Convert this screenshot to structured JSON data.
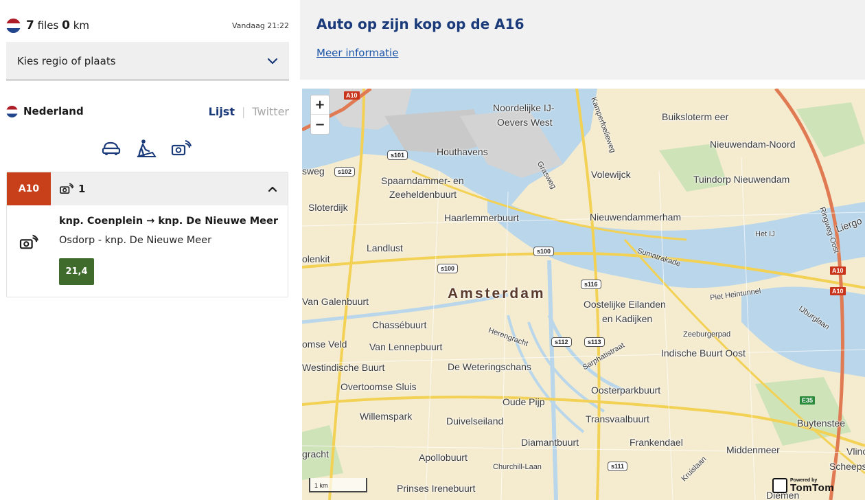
{
  "summary": {
    "files_count": "7",
    "files_label": "files",
    "km_count": "0",
    "km_label": "km",
    "timestamp": "Vandaag 21:22"
  },
  "region_select": {
    "placeholder": "Kies regio of plaats"
  },
  "country": {
    "name": "Nederland"
  },
  "view_tabs": {
    "list": "Lijst",
    "twitter": "Twitter",
    "active": "Lijst"
  },
  "filters": [
    "traffic-jam-icon",
    "roadworks-icon",
    "speed-camera-icon"
  ],
  "road_group": {
    "road": "A10",
    "badge_color": "#c8401a",
    "incident_icon": "speed-camera-icon",
    "count": "1",
    "incidents": [
      {
        "route": "knp. Coenplein → knp. De Nieuwe Meer",
        "stretch": "Osdorp - knp. De Nieuwe Meer",
        "hectometer": "21,4"
      }
    ]
  },
  "news": {
    "title": "Auto op zijn kop op de A16",
    "link": "Meer informatie"
  },
  "map": {
    "zoom_in": "+",
    "zoom_out": "−",
    "city": "Amsterdam",
    "labels": [
      "Noordelijke IJ-",
      "Oevers West",
      "Kamperfoelieweg",
      "Buiksloterm eer",
      "Nieuwendam-Noord",
      "Houthavens",
      "Grasweg",
      "Volewijck",
      "Tuindorp Nieuwendam",
      "Spaarndammer- en",
      "Zeeheldenbuurt",
      "Sloterdijk",
      "Haarlemmerbuurt",
      "Nieuwendammerham",
      "Liergo",
      "Landlust",
      "Het IJ",
      "Sumatrakade",
      "olenkit",
      "Ringweg-Oost",
      "Oostelijke Eilanden",
      "en Kadijken",
      "Van Galenbuurt",
      "Piet Heintunnel",
      "Chassébuurt",
      "Herengracht",
      "Zeeburgerpad",
      "IJburglaan",
      "omse Veld",
      "Van Lennepbuurt",
      "Sarphatistraat",
      "Indische Buurt Oost",
      "Westindische Buurt",
      "De Weteringschans",
      "Overtoomse Sluis",
      "Oosterparkbuurt",
      "Oude Pijp",
      "Willemspark",
      "Duivelseiland",
      "Transvaalbuurt",
      "Buytenstee",
      "Diamantbuurt",
      "Frankendael",
      "Middenmeer",
      "gracht",
      "Apollobuurt",
      "Vlinc",
      "Churchill-Laan",
      "Kruislaan",
      "Scheeps",
      "Prinses Irenebuurt",
      "Diemen",
      "sweg"
    ],
    "shields": [
      "s101",
      "s102",
      "s100",
      "s116",
      "s112",
      "s113",
      "s111"
    ],
    "road_shields": [
      "A10",
      "A10",
      "A10"
    ],
    "euro_shield": "E35",
    "scale": "1 km",
    "attribution_small": "Powered by",
    "attribution_brand": "TomTom"
  }
}
